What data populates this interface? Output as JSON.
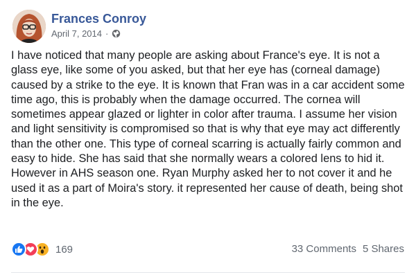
{
  "post": {
    "author": "Frances Conroy",
    "date": "April 7, 2014",
    "separator": "·",
    "privacy_icon": "globe-icon",
    "text": "I have noticed that many people are asking about France's eye. It is not a glass eye, like some of you asked, but that her eye has (corneal damage) caused by a strike to the eye. It is known that Fran was in a car accident some time ago, this is probably when the damage occurred. The cornea will sometimes appear glazed or lighter in color after trauma. I assume her vision and light sensitivity is compromised so that is why that eye may act differently than the other one. This type of corneal scarring is actually fairly common and easy to hide. She has said that she normally wears a colored lens to hid it. However in AHS season one. Ryan Murphy asked her to not cover it and he used it as a part of Moira's story. it represented her cause of death, being shot in the eye."
  },
  "footer": {
    "reaction_icons": [
      "like-icon",
      "love-icon",
      "wow-icon"
    ],
    "reaction_count": "169",
    "comments": "33 Comments",
    "shares": "5 Shares"
  },
  "colors": {
    "author": "#385898",
    "meta": "#616770",
    "like": "#1877f2",
    "love": "#f33e58",
    "wow": "#f7b125"
  }
}
